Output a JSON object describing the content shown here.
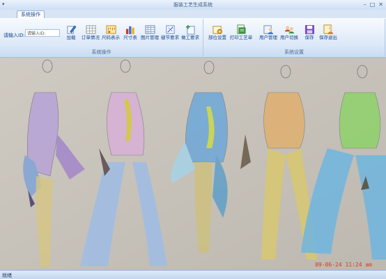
{
  "window": {
    "title": "服装工艺生成系统",
    "qat_icon": "quick-access-arrow"
  },
  "tabs": [
    {
      "label": "系统操作"
    }
  ],
  "ribbon": {
    "group1": {
      "label": "系统操作",
      "input_label": "请输入ID:",
      "input_value": "请输入ID:",
      "buttons": [
        {
          "label": "加载",
          "icon": "pencil-load-icon"
        },
        {
          "label": "订单情况",
          "icon": "table-icon"
        },
        {
          "label": "尺码表示",
          "icon": "ruler-icon"
        },
        {
          "label": "尺寸表",
          "icon": "bar-chart-icon"
        },
        {
          "label": "图片管理",
          "icon": "grid-image-icon"
        },
        {
          "label": "缝节要求",
          "icon": "sewing-icon"
        },
        {
          "label": "做工要求",
          "icon": "plus-sheet-icon"
        }
      ]
    },
    "group2": {
      "label": "系统设置",
      "buttons": [
        {
          "label": "部位设置",
          "icon": "settings-parts-icon"
        },
        {
          "label": "打印工艺单",
          "icon": "print-icon"
        },
        {
          "label": "用户管理",
          "icon": "users-icon"
        },
        {
          "label": "用户切换",
          "icon": "user-switch-icon"
        },
        {
          "label": "保存",
          "icon": "save-icon"
        },
        {
          "label": "保存退出",
          "icon": "save-exit-icon"
        }
      ]
    }
  },
  "content": {
    "stamp": "09-06-24 11:24 am"
  },
  "status": {
    "text": "就绪"
  }
}
